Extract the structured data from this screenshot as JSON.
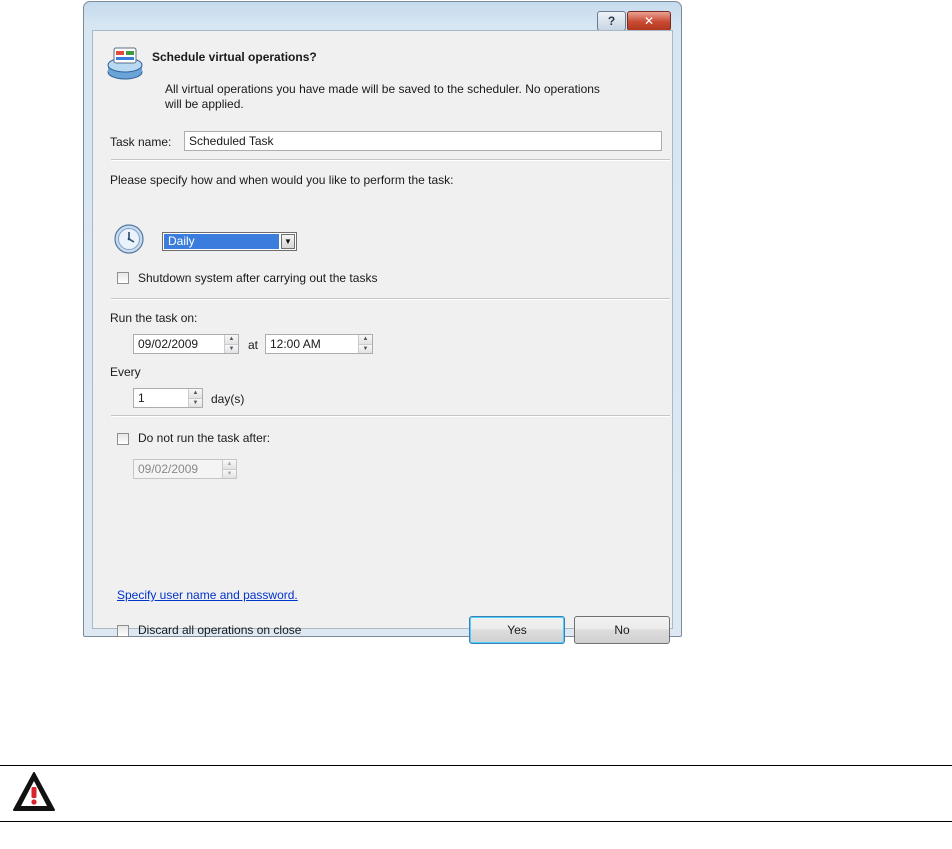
{
  "dialog": {
    "help_glyph": "?",
    "close_glyph": "✕",
    "icon": "schedule-operations-icon",
    "title": "Schedule virtual operations?",
    "description": "All virtual operations you have made will be saved to the scheduler. No operations will be applied.",
    "task_name_label": "Task name:",
    "task_name_value": "Scheduled Task",
    "schedule_prompt": "Please specify how and when would you like to perform the task:",
    "clock_icon": "clock-icon",
    "frequency_selected": "Daily",
    "shutdown_label": "Shutdown system after carrying out the tasks",
    "shutdown_checked": false,
    "run_on_label": "Run the task on:",
    "run_date": "09/02/2009",
    "at_label": "at",
    "run_time": "12:00 AM",
    "every_label": "Every",
    "every_value": "1",
    "every_unit": "day(s)",
    "end_label": "Do not run the task after:",
    "end_checked": false,
    "end_date": "09/02/2009",
    "credentials_link": "Specify user name and password.",
    "discard_label": "Discard all operations on close",
    "discard_checked": false,
    "yes_label": "Yes",
    "no_label": "No"
  },
  "footer": {
    "warning_icon": "warning-icon"
  },
  "colors": {
    "selection": "#3b7ddd",
    "link": "#0033cc",
    "close_button": "#c84a33",
    "warning": "#d9242b"
  }
}
